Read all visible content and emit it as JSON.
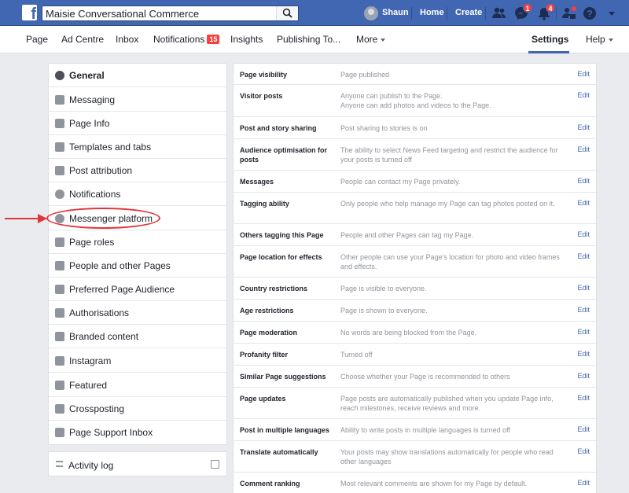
{
  "topbar": {
    "search_value": "Maisie Conversational Commerce",
    "user_name": "Shaun",
    "home": "Home",
    "create": "Create",
    "messenger_count": "1",
    "notifications_count": "4"
  },
  "pagenav": {
    "items": [
      "Page",
      "Ad Centre",
      "Inbox",
      "Notifications",
      "Insights",
      "Publishing To...",
      "More"
    ],
    "notifications_badge": "15",
    "settings": "Settings",
    "help": "Help"
  },
  "sidebar": {
    "items": [
      {
        "label": "General",
        "icon": "gear-icon"
      },
      {
        "label": "Messaging",
        "icon": "messaging-icon"
      },
      {
        "label": "Page Info",
        "icon": "pencil-icon"
      },
      {
        "label": "Templates and tabs",
        "icon": "grid-icon"
      },
      {
        "label": "Post attribution",
        "icon": "flag-icon"
      },
      {
        "label": "Notifications",
        "icon": "globe-icon"
      },
      {
        "label": "Messenger platform",
        "icon": "messenger-icon"
      },
      {
        "label": "Page roles",
        "icon": "person-icon"
      },
      {
        "label": "People and other Pages",
        "icon": "people-icon"
      },
      {
        "label": "Preferred Page Audience",
        "icon": "people-icon"
      },
      {
        "label": "Authorisations",
        "icon": "wrench-icon"
      },
      {
        "label": "Branded content",
        "icon": "handshake-icon"
      },
      {
        "label": "Instagram",
        "icon": "instagram-icon"
      },
      {
        "label": "Featured",
        "icon": "star-icon"
      },
      {
        "label": "Crossposting",
        "icon": "video-icon"
      },
      {
        "label": "Page Support Inbox",
        "icon": "inbox-icon"
      }
    ],
    "activity_log": "Activity log"
  },
  "settings": {
    "edit_label": "Edit",
    "rows": [
      {
        "label": "Page visibility",
        "desc": "Page published"
      },
      {
        "label": "Visitor posts",
        "desc": "Anyone can publish to the Page.\nAnyone can add photos and videos to the Page."
      },
      {
        "label": "Post and story sharing",
        "desc": "Post sharing to stories is on"
      },
      {
        "label": "Audience optimisation for posts",
        "desc": "The ability to select News Feed targeting and restrict the audience for your posts is turned off"
      },
      {
        "label": "Messages",
        "desc": "People can contact my Page privately."
      },
      {
        "label": "Tagging ability",
        "desc": "Only people who help manage my Page can tag photos posted on it."
      },
      {
        "label": "Others tagging this Page",
        "desc": "People and other Pages can tag my Page."
      },
      {
        "label": "Page location for effects",
        "desc": "Other people can use your Page's location for photo and video frames and effects."
      },
      {
        "label": "Country restrictions",
        "desc": "Page is visible to everyone."
      },
      {
        "label": "Age restrictions",
        "desc": "Page is shown to everyone."
      },
      {
        "label": "Page moderation",
        "desc": "No words are being blocked from the Page."
      },
      {
        "label": "Profanity filter",
        "desc": "Turned off"
      },
      {
        "label": "Similar Page suggestions",
        "desc": "Choose whether your Page is recommended to others"
      },
      {
        "label": "Page updates",
        "desc": "Page posts are automatically published when you update Page info, reach milestones, receive reviews and more."
      },
      {
        "label": "Post in multiple languages",
        "desc": "Ability to write posts in multiple languages is turned off"
      },
      {
        "label": "Translate automatically",
        "desc": "Your posts may show translations automatically for people who read other languages"
      },
      {
        "label": "Comment ranking",
        "desc": "Most relevant comments are shown for my Page by default."
      }
    ]
  },
  "colors": {
    "brand": "#4267b2",
    "badge": "#fa3e3e",
    "annotation": "#e0353b"
  }
}
